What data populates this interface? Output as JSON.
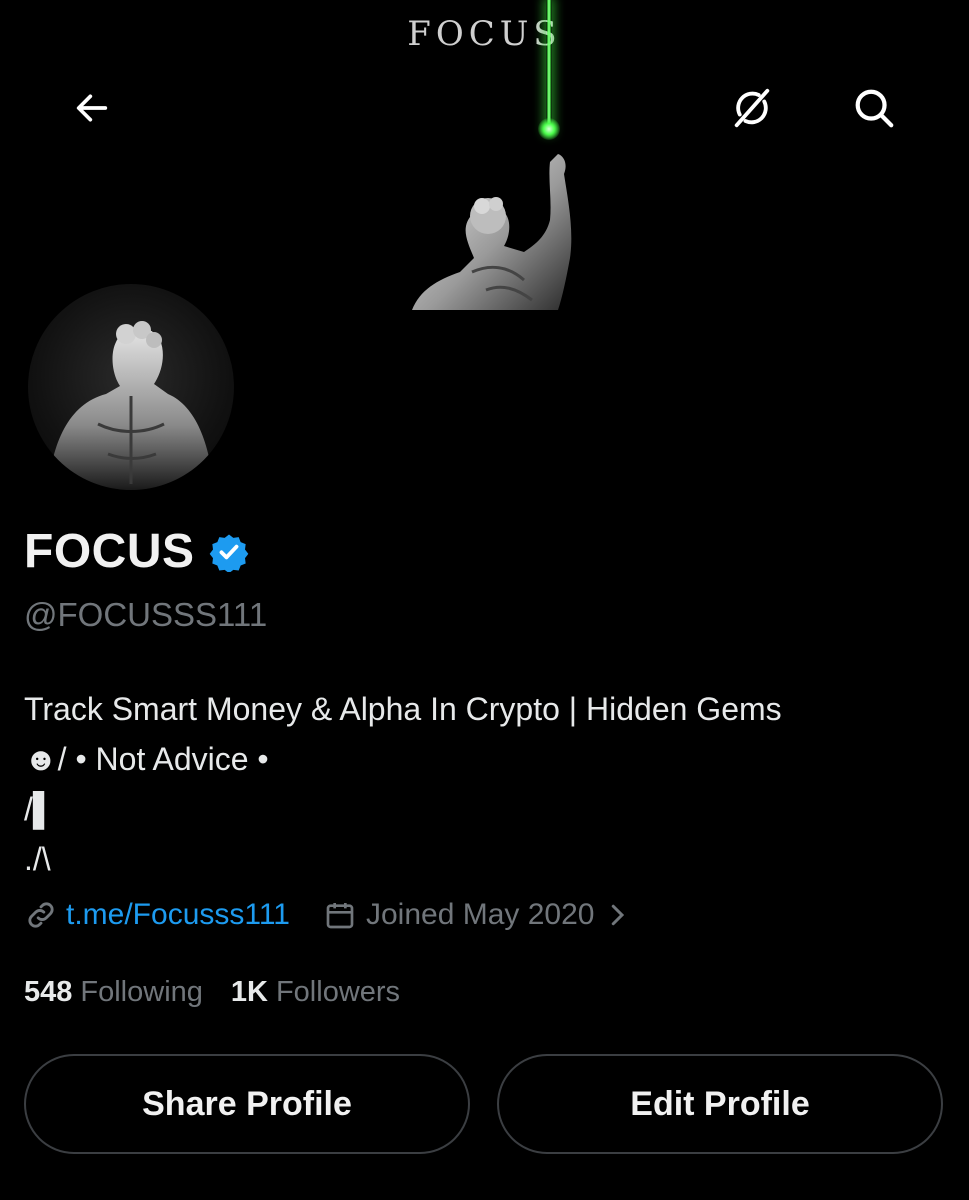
{
  "banner": {
    "title": "FOCUS"
  },
  "header": {
    "back_icon": "arrow-left-icon",
    "grok_icon": "grok-icon",
    "search_icon": "search-icon"
  },
  "profile": {
    "name": "FOCUS",
    "handle": "@FOCUSSS111",
    "verified_color": "#1d9bf0",
    "bio_lines": [
      "Track Smart Money & Alpha In Crypto | Hidden Gems",
      "☻/ • Not Advice •",
      "/▌",
      "./\\"
    ],
    "link": "t.me/Focusss111",
    "joined": "Joined May 2020"
  },
  "stats": {
    "following_count": "548",
    "following_label": "Following",
    "followers_count": "1K",
    "followers_label": "Followers"
  },
  "buttons": {
    "share": "Share Profile",
    "edit": "Edit Profile"
  },
  "colors": {
    "background": "#000000",
    "accent": "#1d9bf0",
    "laser": "#4cff4c",
    "muted": "#71767b"
  }
}
